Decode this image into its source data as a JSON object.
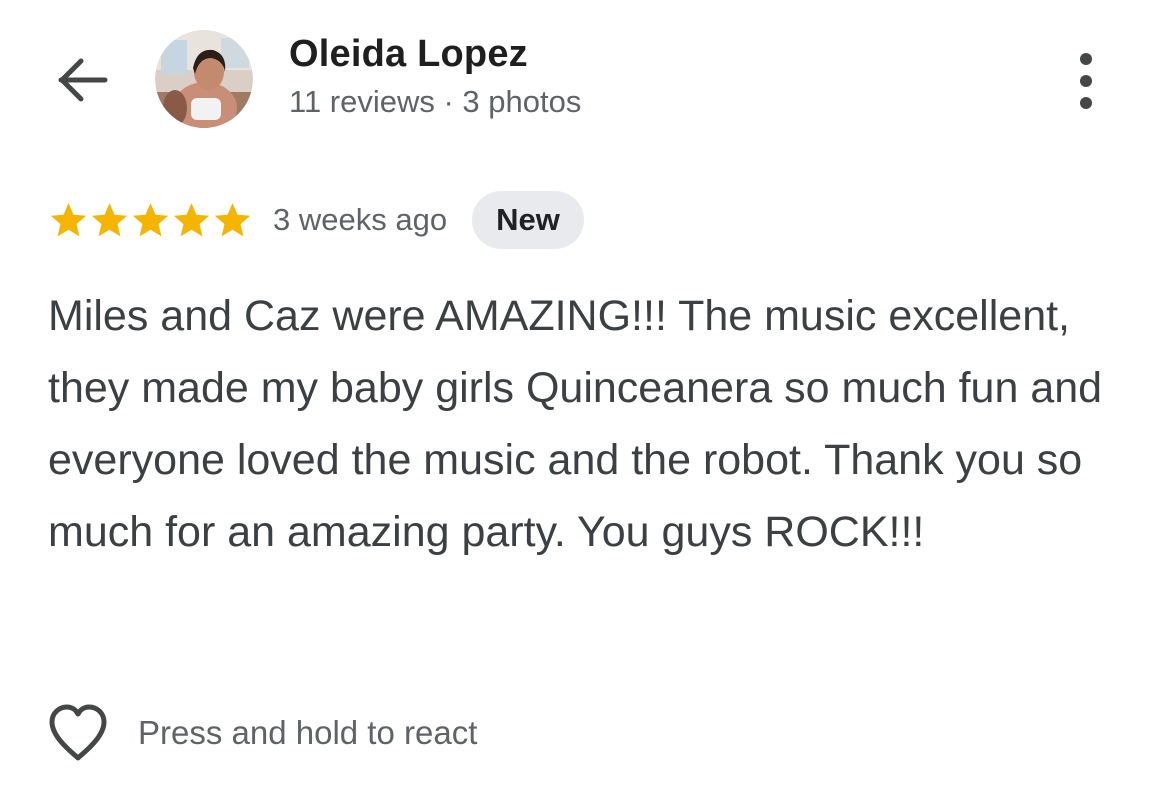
{
  "header": {
    "back_icon": "arrow-back-icon",
    "author_name": "Oleida Lopez",
    "author_meta": "11 reviews · 3 photos",
    "more_icon": "more-vertical-icon"
  },
  "review": {
    "rating": 5,
    "rating_max": 5,
    "star_color": "#f5b400",
    "time": "3 weeks ago",
    "badge": "New",
    "text": "Miles and Caz were AMAZING!!! The music excellent, they made my baby girls Quinceanera so much fun and everyone loved the music and the robot. Thank you so much for an amazing party. You guys ROCK!!!"
  },
  "reactions": {
    "icon": "heart-outline-icon",
    "label": "Press and hold to react"
  },
  "colors": {
    "primary_text": "#1f1f1f",
    "secondary_text": "#5f6368",
    "badge_bg": "#e8eaed"
  }
}
